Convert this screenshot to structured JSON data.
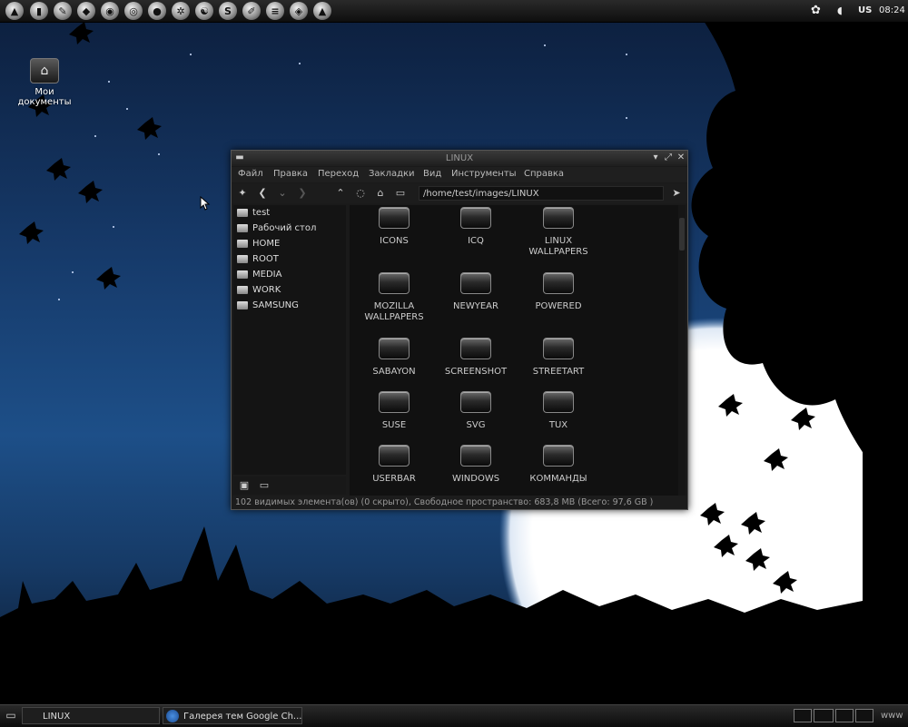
{
  "top_panel": {
    "launchers": [
      "app-menu-icon",
      "terminal-icon",
      "gimp-icon",
      "inkscape-icon",
      "eye-of-gnome-icon",
      "blender-icon",
      "chrome-icon",
      "settings-icon",
      "system-icon",
      "skype-icon",
      "notes-icon",
      "mail-icon",
      "camera-icon",
      "vlc-icon"
    ],
    "keyboard_layout": "US",
    "clock": "08:24"
  },
  "desktop": {
    "icon_label": "Мои документы"
  },
  "window": {
    "title": "LINUX",
    "menu": [
      "Файл",
      "Правка",
      "Переход",
      "Закладки",
      "Вид",
      "Инструменты",
      "Справка"
    ],
    "path": "/home/test/images/LINUX",
    "sidebar": [
      "test",
      "Рабочий стол",
      "HOME",
      "ROOT",
      "MEDIA",
      "WORK",
      "SAMSUNG"
    ],
    "folders": [
      [
        "ICONS"
      ],
      [
        "ICQ"
      ],
      [
        "LINUX",
        "WALLPAPERS"
      ],
      [
        "MOZILLA",
        "WALLPAPERS"
      ],
      [
        "NEWYEAR"
      ],
      [
        "POWERED"
      ],
      [
        "SABAYON"
      ],
      [
        "SCREENSHOT"
      ],
      [
        "STREETART"
      ],
      [
        "SUSE"
      ],
      [
        "SVG"
      ],
      [
        "TUX"
      ],
      [
        "USERBAR"
      ],
      [
        "WINDOWS"
      ],
      [
        "КОММАНДЫ"
      ]
    ],
    "status": "102 видимых элемента(ов) (0 скрыто), Свободное пространство: 683,8 MB (Всего: 97,6 GB )"
  },
  "taskbar": {
    "tasks": [
      "LINUX",
      "Галерея тем Google Ch..."
    ],
    "tray_text": "www"
  }
}
